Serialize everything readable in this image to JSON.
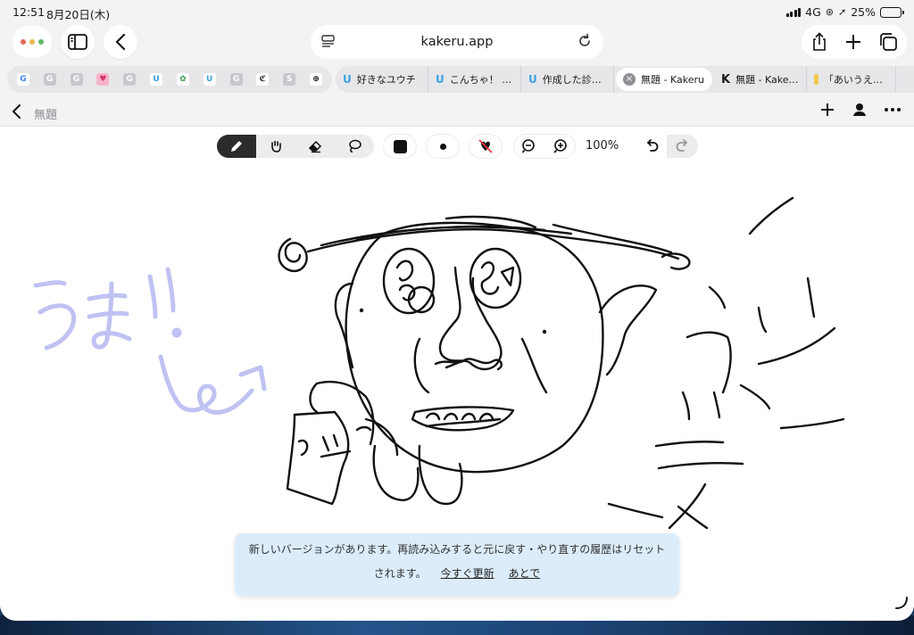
{
  "status": {
    "time": "12:51",
    "date": "8月20日(木)",
    "network": "4G",
    "battery": "25%",
    "battery_level": 0.25
  },
  "browser": {
    "url": "kakeru.app",
    "pinned_tabs": [
      {
        "icon": "google-icon",
        "glyph": "G"
      },
      {
        "icon": "g-tile-icon",
        "glyph": "G"
      },
      {
        "icon": "g-tile-icon",
        "glyph": "G"
      },
      {
        "icon": "heart-icon",
        "glyph": "♥"
      },
      {
        "icon": "g-tile-icon",
        "glyph": "G"
      },
      {
        "icon": "rainbow-u-icon",
        "glyph": "U"
      },
      {
        "icon": "plant-icon",
        "glyph": "✿"
      },
      {
        "icon": "rainbow-u-icon",
        "glyph": "U"
      },
      {
        "icon": "g-tile-icon",
        "glyph": "G"
      },
      {
        "icon": "cursive-logo-icon",
        "glyph": "ℭ"
      },
      {
        "icon": "s-tile-icon",
        "glyph": "S"
      },
      {
        "icon": "globe-icon",
        "glyph": "⊕"
      }
    ],
    "tabs": [
      {
        "label": "好きなユウチ",
        "icon": "rainbow-u-icon"
      },
      {
        "label": "こんちゃ！ |...",
        "icon": "rainbow-u-icon"
      },
      {
        "label": "作成した診断…",
        "icon": "rainbow-u-icon"
      },
      {
        "label": "無題 - Kakeru",
        "icon": "close-icon",
        "active": true
      },
      {
        "label": "無題 - Kakeru",
        "icon": "kakeru-k-icon"
      },
      {
        "label": "「あいうえお」…",
        "icon": "yellow-icon"
      }
    ]
  },
  "app": {
    "title": "無題",
    "zoom": "100%"
  },
  "notice": {
    "line1": "新しいバージョンがあります。再読み込みすると元に戻す・やり直すの履歴はリセット",
    "line2": "されます。",
    "update_link": "今すぐ更新",
    "later_link": "あとで"
  }
}
